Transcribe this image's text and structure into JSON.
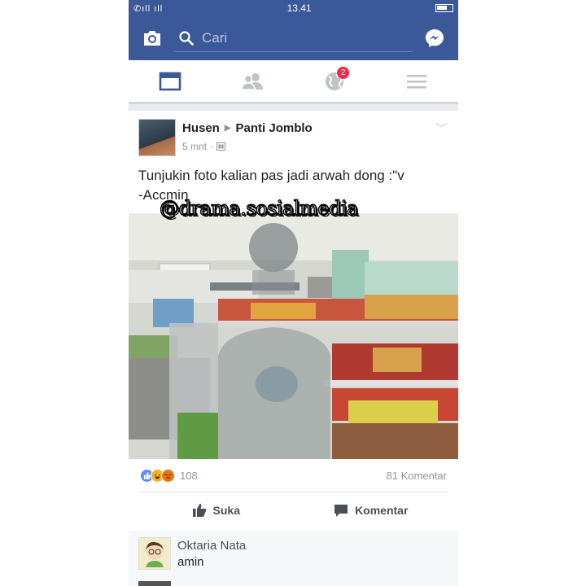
{
  "status_bar": {
    "signal": "✆ıll ıll",
    "time": "13.41"
  },
  "header": {
    "search_placeholder": "Cari"
  },
  "tabs": [
    {
      "name": "news-feed",
      "icon": "news-feed-icon",
      "active": true
    },
    {
      "name": "friends",
      "icon": "friends-icon"
    },
    {
      "name": "notifications",
      "icon": "globe-icon",
      "badge": "2"
    },
    {
      "name": "menu",
      "icon": "menu-icon"
    }
  ],
  "post": {
    "author": "Husen",
    "group": "Panti Jomblo",
    "time": "5 mnt",
    "text": "Tunjukin foto kalian pas jadi arwah dong :\"v\n-Accmin",
    "watermark": "@drama.sosialmedia",
    "reaction_count": "108",
    "comment_count": "81 Komentar",
    "like_label": "Suka",
    "comment_label": "Komentar"
  },
  "comment": {
    "author": "Oktaria Nata",
    "text": "amin"
  },
  "colors": {
    "brand": "#3b5998",
    "badge": "#f02849"
  }
}
